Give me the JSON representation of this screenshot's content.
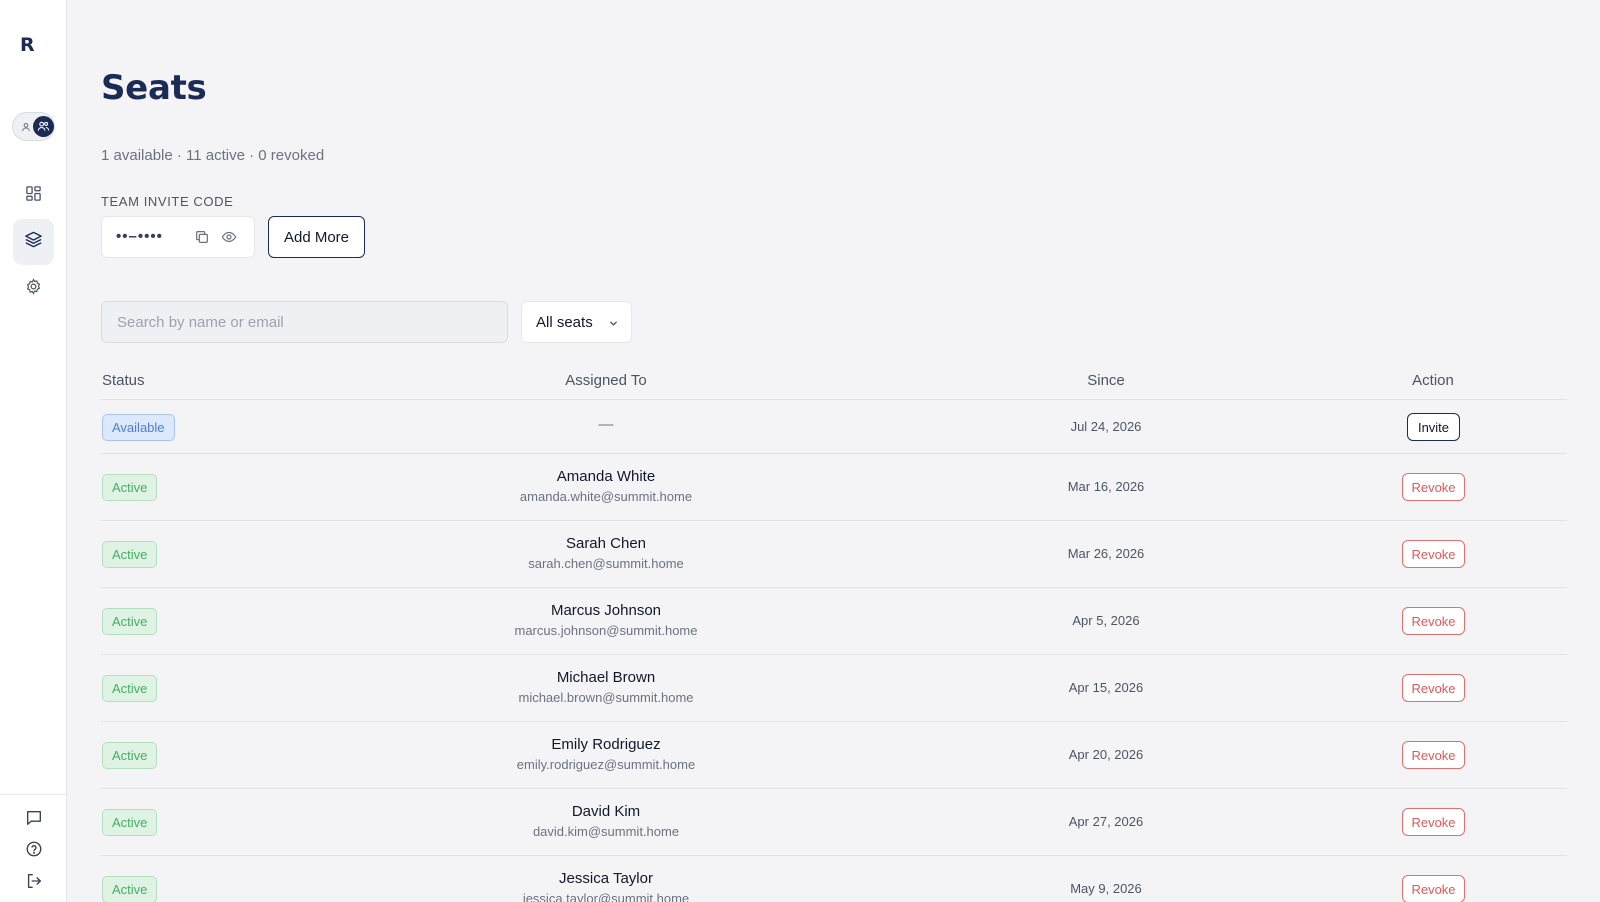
{
  "app": {
    "logo": "R"
  },
  "sidebar": {
    "nav": [
      {
        "id": "dashboard",
        "icon": "dashboard-icon"
      },
      {
        "id": "seats",
        "icon": "layers-icon",
        "active": true
      },
      {
        "id": "settings",
        "icon": "gear-icon"
      }
    ],
    "footer": [
      {
        "id": "feedback",
        "icon": "message-icon"
      },
      {
        "id": "help",
        "icon": "help-circle-icon"
      },
      {
        "id": "logout",
        "icon": "logout-icon"
      }
    ]
  },
  "page": {
    "title": "Seats",
    "summary": "1 available · 11 active · 0 revoked",
    "invite_label": "TEAM INVITE CODE",
    "invite_code_masked": "••–••••",
    "add_more_label": "Add More"
  },
  "search": {
    "placeholder": "Search by name or email",
    "value": ""
  },
  "filter": {
    "selected": "All seats"
  },
  "table": {
    "columns": {
      "status": "Status",
      "assigned": "Assigned To",
      "since": "Since",
      "action": "Action"
    },
    "rows": [
      {
        "status": "Available",
        "assigned_placeholder": "—",
        "since": "Jul 24, 2026",
        "action": "Invite"
      },
      {
        "status": "Active",
        "name": "Amanda White",
        "email": "amanda.white@summit.home",
        "since": "Mar 16, 2026",
        "action": "Revoke"
      },
      {
        "status": "Active",
        "name": "Sarah Chen",
        "email": "sarah.chen@summit.home",
        "since": "Mar 26, 2026",
        "action": "Revoke"
      },
      {
        "status": "Active",
        "name": "Marcus Johnson",
        "email": "marcus.johnson@summit.home",
        "since": "Apr 5, 2026",
        "action": "Revoke"
      },
      {
        "status": "Active",
        "name": "Michael Brown",
        "email": "michael.brown@summit.home",
        "since": "Apr 15, 2026",
        "action": "Revoke"
      },
      {
        "status": "Active",
        "name": "Emily Rodriguez",
        "email": "emily.rodriguez@summit.home",
        "since": "Apr 20, 2026",
        "action": "Revoke"
      },
      {
        "status": "Active",
        "name": "David Kim",
        "email": "david.kim@summit.home",
        "since": "Apr 27, 2026",
        "action": "Revoke"
      },
      {
        "status": "Active",
        "name": "Jessica Taylor",
        "email": "jessica.taylor@summit.home",
        "since": "May 9, 2026",
        "action": "Revoke"
      }
    ]
  },
  "colors": {
    "brand": "#1b2b55",
    "available": "#4f7fd0",
    "active": "#46ad63",
    "revoke": "#dc5a5a"
  }
}
